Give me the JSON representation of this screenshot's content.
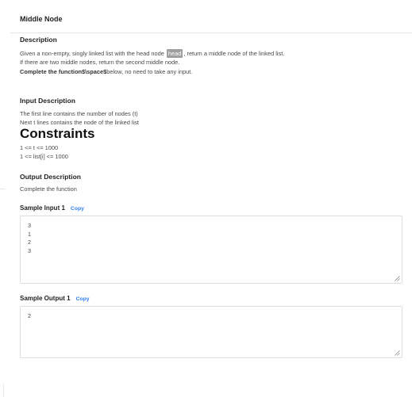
{
  "problem": {
    "title": "Middle Node",
    "description_heading": "Description",
    "description_line1_before": "Given a non-empty, singly linked list with the head node",
    "description_code": "head",
    "description_line1_after": ", return a middle node of the linked list.",
    "description_line2": "If there are two middle nodes, return the second middle node.",
    "description_line3_bold": "Complete the function$\\space$",
    "description_line3_rest": "below, no need to take any input.",
    "input_heading": "Input Description",
    "input_line1": "The first line contains the number of nodes (t)",
    "input_line2": "Next t lines contains the node of the linked list",
    "constraints_heading": "Constraints",
    "constraint1": "1 <= t <= 1000",
    "constraint2": "1 <= list[i] <= 1000",
    "output_heading": "Output Description",
    "output_line1": "Complete the function"
  },
  "samples": {
    "input_label": "Sample Input 1",
    "input_copy": "Copy",
    "input_value": "3\n1\n2\n3",
    "output_label": "Sample Output 1",
    "output_copy": "Copy",
    "output_value": "2"
  }
}
